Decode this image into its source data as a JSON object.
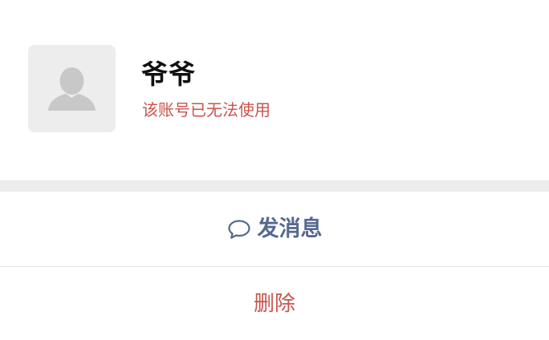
{
  "profile": {
    "name": "爷爷",
    "status": "该账号已无法使用",
    "avatar_icon": "default-avatar-icon"
  },
  "actions": {
    "message_label": "发消息",
    "message_icon": "chat-bubble-icon",
    "delete_label": "删除"
  },
  "colors": {
    "name": "#111111",
    "status_red": "#c9544c",
    "message_blue": "#55688f",
    "delete_red": "#c9544c",
    "section_gap": "#ececec",
    "avatar_bg": "#ededed"
  }
}
